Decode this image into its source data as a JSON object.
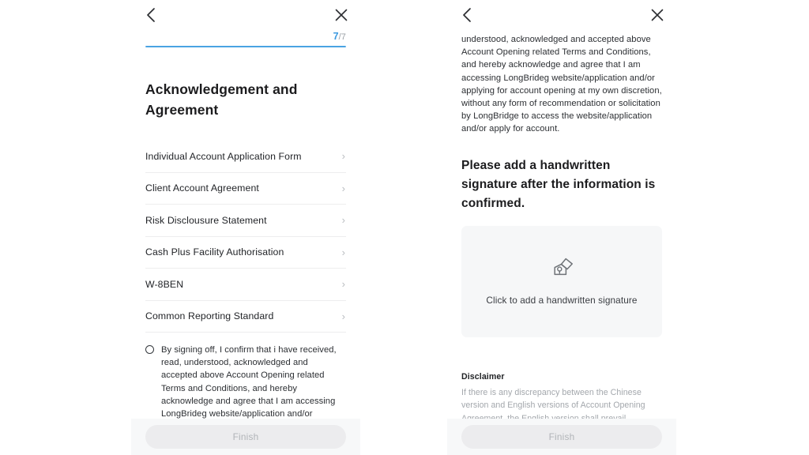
{
  "app": {
    "brand_blue": "#4aa3e3",
    "text_primary": "#1c1c1e",
    "text_muted": "#a3a7ac",
    "surface_gray": "#f6f7f8"
  },
  "left_panel": {
    "nav": {
      "back_icon": "chevron-left-icon",
      "close_icon": "close-icon"
    },
    "progress": {
      "current": "7",
      "total": "/7",
      "percent": 100
    },
    "title": "Acknowledgement and Agreement",
    "documents": [
      {
        "label": "Individual Account Application Form",
        "chevron": "›"
      },
      {
        "label": "Client Account Agreement",
        "chevron": "›"
      },
      {
        "label": "Risk Disclousure Statement",
        "chevron": "›"
      },
      {
        "label": "Cash Plus Facility Authorisation",
        "chevron": "›"
      },
      {
        "label": "W-8BEN",
        "chevron": "›"
      },
      {
        "label": "Common Reporting Standard",
        "chevron": "›"
      }
    ],
    "consent": {
      "checked": false,
      "text": "By signing off, I confirm that i have received, read, understood, acknowledged and accepted above Account Opening related Terms and Conditions, and hereby acknowledge and agree that I am accessing LongBrideg website/application and/or applying for account opening at my own discretion, without any"
    },
    "footer": {
      "finish_label": "Finish",
      "finish_enabled": false
    }
  },
  "right_panel": {
    "nav": {
      "back_icon": "chevron-left-icon",
      "close_icon": "close-icon"
    },
    "continued_text": "understood, acknowledged and accepted above Account Opening related Terms and Conditions, and hereby acknowledge and agree that I am accessing LongBrideg website/application and/or applying for account opening at my own discretion, without any form of recommendation or solicitation by LongBridge to access the website/application and/or apply for account.",
    "signature": {
      "heading": "Please add a handwritten signature after the information is confirmed.",
      "icon": "signature-stamp-icon",
      "cta": "Click to add a handwritten signature"
    },
    "disclaimer": {
      "title": "Disclaimer",
      "body": "If there is any discrepancy between the Chinese version and English versions of Account Opening Agreement, the English version shall prevail."
    },
    "footer": {
      "finish_label": "Finish",
      "finish_enabled": false
    }
  }
}
